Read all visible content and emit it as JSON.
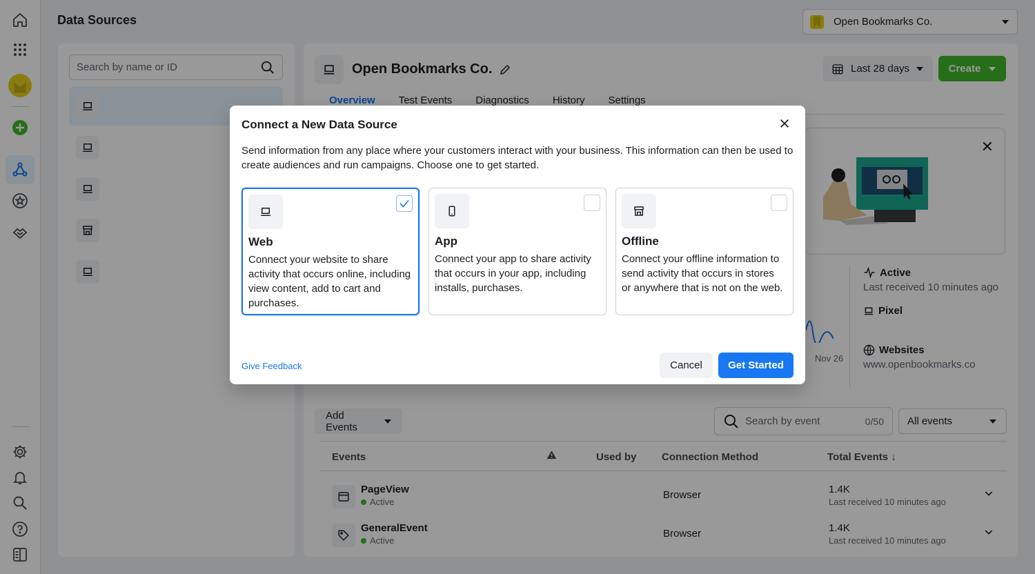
{
  "header": {
    "title": "Data Sources",
    "account_name": "Open Bookmarks Co."
  },
  "left_panel": {
    "search_placeholder": "Search by name or ID"
  },
  "main": {
    "pixel_name": "Open Bookmarks Co.",
    "date_range": "Last 28 days",
    "create_label": "Create",
    "tabs": [
      "Overview",
      "Test Events",
      "Diagnostics",
      "History",
      "Settings"
    ],
    "chart_x_label": "Nov 26",
    "status": {
      "active_label": "Active",
      "last_received": "Last received 10 minutes ago",
      "pixel_label": "Pixel",
      "websites_label": "Websites",
      "website_url": "www.openbookmarks.co"
    },
    "events_toolbar": {
      "add_events": "Add Events",
      "search_placeholder": "Search by event",
      "search_count": "0/50",
      "filter": "All events"
    },
    "table": {
      "headers": {
        "events": "Events",
        "used_by": "Used by",
        "connection": "Connection Method",
        "total": "Total Events ↓"
      },
      "rows": [
        {
          "name": "PageView",
          "status": "Active",
          "connection": "Browser",
          "total": "1.4K",
          "received": "Last received 10 minutes ago"
        },
        {
          "name": "GeneralEvent",
          "status": "Active",
          "connection": "Browser",
          "total": "1.4K",
          "received": "Last received 10 minutes ago"
        }
      ]
    }
  },
  "modal": {
    "title": "Connect a New Data Source",
    "description": "Send information from any place where your customers interact with your business. This information can then be used to create audiences and run campaigns. Choose one to get started.",
    "options": [
      {
        "name": "Web",
        "description": "Connect your website to share activity that occurs online, including view content, add to cart and purchases.",
        "icon": "laptop-icon",
        "selected": true
      },
      {
        "name": "App",
        "description": "Connect your app to share activity that occurs in your app, including installs, purchases.",
        "icon": "phone-icon",
        "selected": false
      },
      {
        "name": "Offline",
        "description": "Connect your offline information to send activity that occurs in stores or anywhere that is not on the web.",
        "icon": "store-icon",
        "selected": false
      }
    ],
    "feedback_link": "Give Feedback",
    "cancel_label": "Cancel",
    "start_label": "Get Started"
  },
  "colors": {
    "accent": "#1877f2",
    "create": "#42b72a",
    "active_dot": "#42b72a"
  }
}
